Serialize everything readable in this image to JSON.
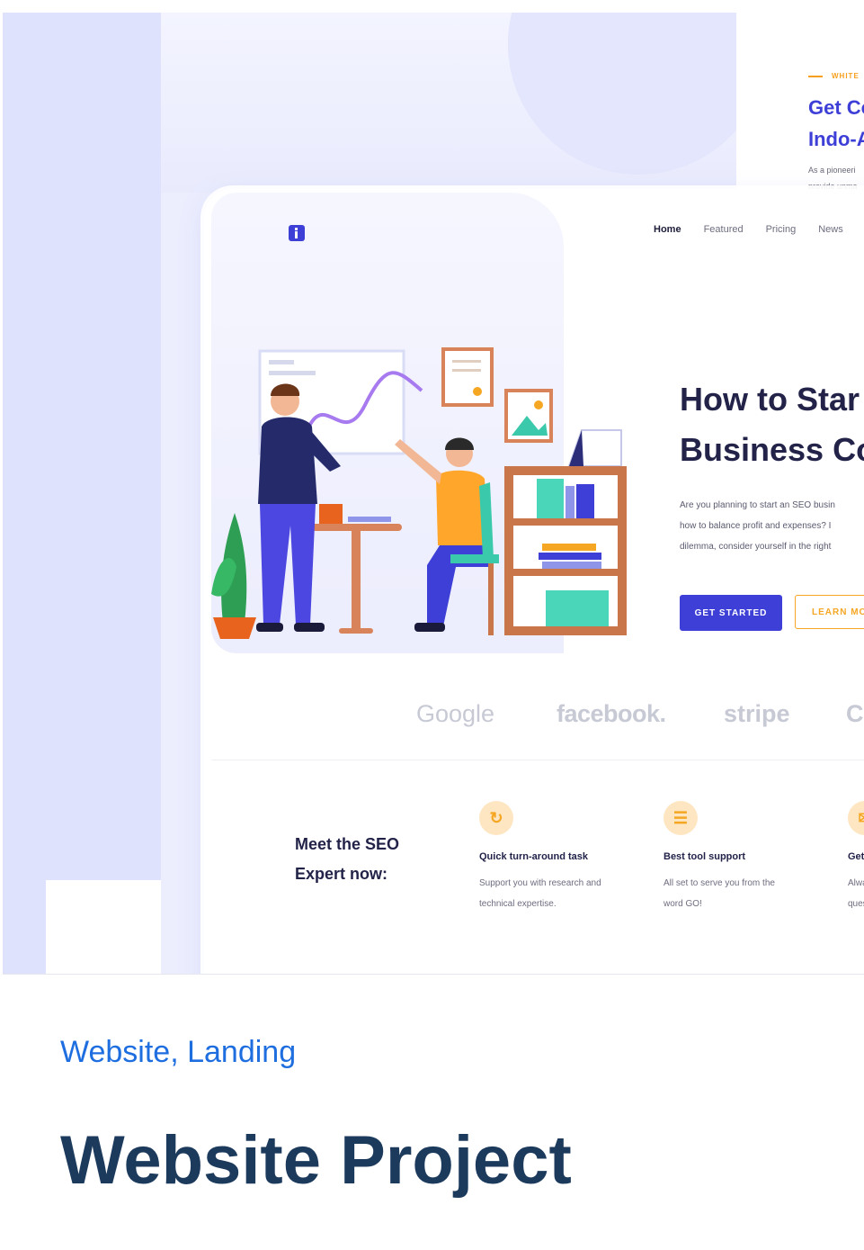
{
  "back_card": {
    "tag": "WHITE",
    "heading_line1": "Get Co",
    "heading_line2": "Indo-A",
    "para_line1": "As a pioneeri",
    "para_line2": "provide unma"
  },
  "nav": {
    "items": [
      "Home",
      "Featured",
      "Pricing",
      "News"
    ]
  },
  "hero": {
    "title_line1": "How to Star",
    "title_line2": "Business Co",
    "text_line1": "Are you planning to start an SEO busin",
    "text_line2": "how to balance profit and expenses? I",
    "text_line3": "dilemma, consider yourself in the right",
    "primary_button": "GET STARTED",
    "secondary_button": "LEARN MOR"
  },
  "brands": [
    "Google",
    "facebook.",
    "stripe",
    "C"
  ],
  "meet": {
    "line1": "Meet the SEO",
    "line2": "Expert now:"
  },
  "features": [
    {
      "icon": "refresh-icon",
      "title": "Quick turn-around task",
      "desc_line1": "Support you with research and",
      "desc_line2": "technical expertise."
    },
    {
      "icon": "layers-icon",
      "title": "Best tool support",
      "desc_line1": "All set to serve you from the",
      "desc_line2": "word GO!"
    },
    {
      "icon": "chat-icon",
      "title": "Get",
      "desc_line1": "Alwa",
      "desc_line2": "ques"
    }
  ],
  "project": {
    "category": "Website, Landing",
    "title": "Website Project"
  },
  "colors": {
    "primary": "#3d3fd6",
    "accent": "#f5a623",
    "category_blue": "#1e6ee0",
    "title_navy": "#1c3a5c"
  }
}
